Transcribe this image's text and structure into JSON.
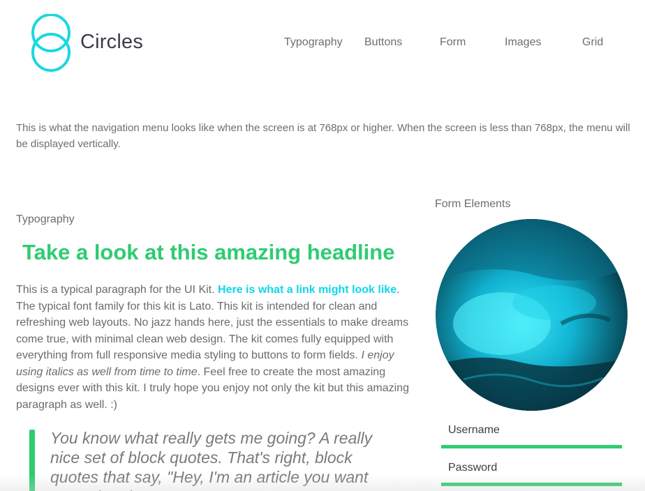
{
  "brand": {
    "name": "Circles",
    "logo_icon": "double-circle-logo-icon"
  },
  "nav": {
    "items": [
      {
        "label": "Typography"
      },
      {
        "label": "Buttons"
      },
      {
        "label": "Form"
      },
      {
        "label": "Images"
      },
      {
        "label": "Grid"
      }
    ]
  },
  "notice": "This is what the navigation menu looks like when the screen is at 768px or higher. When the screen is less than 768px, the menu will be displayed vertically.",
  "typography": {
    "label": "Typography",
    "headline": "Take a look at this amazing headline",
    "para_start": "This is a typical paragraph for the UI Kit. ",
    "link": "Here is what a link might look like",
    "para_middle": ". The typical font family for this kit is Lato. This kit is intended for clean and refreshing web layouts. No jazz hands here, just the essentials to make dreams come true, with minimal clean web design. The kit comes fully equipped with everything from full responsive media styling to buttons to form fields. ",
    "para_italic": "I enjoy using italics as well from time to time",
    "para_end": ". Feel free to create the most amazing designs ever with this kit. I truly hope you enjoy not only the kit but this amazing paragraph as well. :)",
    "quote": "You know what really gets me going? A really nice set of block quotes. That's right, block quotes that say, \"Hey, I'm an article you want to read and nurture.\""
  },
  "form": {
    "label": "Form Elements",
    "image_icon": "ocean-wave-image",
    "username_placeholder": "Username",
    "password_placeholder": "Password"
  },
  "colors": {
    "accent": "#2ecc71",
    "link": "#0fd6e8",
    "logo": "#19d8e0",
    "text": "#6e6e6e",
    "brand_text": "#3a3d44"
  }
}
